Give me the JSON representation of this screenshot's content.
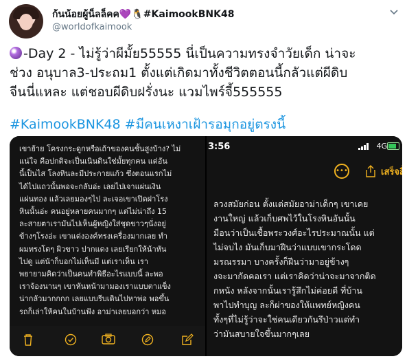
{
  "tweet": {
    "display_name": "ก้นน้อยผู้น็ลล็คค",
    "name_icons": "💜🐧",
    "name_tag": "#KaimookBNK48",
    "handle": "@worldofkaimook",
    "body_line1": "-Day 2 - ไม่รู้ว่าผีมั้ย55555 นี่เป็นความทรงจำวัยเด็ก น่าจะ",
    "body_line2": "ช่วง อนุบาล3-ประถม1 ตั้งแต่เกิดมาทั้งชีวิตตอนนี้กลัวแต่ผีดิบ",
    "body_line3": "จีนนี่แหละ แต่ชอบผีดิบฝรั่งนะ แวมไพร์จี้555555",
    "hashtags": "#KaimookBNK48 #มีคนเหงาเฝ้ารอมุกอยู่ตรงนี้",
    "more_icon": "chevron-down-icon",
    "orb_icon": "crystal-ball-icon"
  },
  "photo_left": {
    "lines": [
      "เขาย้าย โครงกระดูกหรือเถ้าของคนชั้นสูงบ้าง? ไม่",
      "แน่ใจ คือปกติจะเป็นเนินดินใช่มั้ยทุกคน แต่อัน",
      "นี้เป็นไส โลงหินละมีประกายแก้ว ซึ่งตอนแรกไม่",
      "ได้ไปแถวนั้นพอจะกลับอ่ะ เลยไปเจาแผ่นเงิน",
      "แผ่นทอง แล้วเลยมองๆไป ละเจอเขาเปิดฝาโรง",
      "หินนั้นอ่ะ คนอยู่หลายคนมากๆ แต่ไม่น่าถึง 15",
      "ละสายตาเรามันไปเห็นผู้หญิงใส่ชุดขาวๆนั่งอยู่",
      "ข้างๆโรงอ่ะ เขาแต่งองค์ทรงเครื่องมากเลย ทำ",
      "ผมทรงโตๆ ผิวขาว ปากแดง เลยเรียกให้น้าหัน",
      "ไปดู แต่น้าก็บอกไม่เห็นมี แต่เราเห็น เรา",
      "พยายามคิดว่าเป็นคนทำพิธีอะไรแบบนี้ ละพอ",
      "เราจ้องนานๆ เขาหันหน้ามามองเราแบบตาแข็ง",
      "น่ากลัวมากกกก เลยแบบรีบเดินไปหาพ่อ พอขึ้น",
      "รถก็เล่าให้คนในบ้านฟัง อาม่าเลยบอกว่า หมอ"
    ]
  },
  "photo_right": {
    "time": "3:56",
    "network": "4G",
    "battery_level": 0.8,
    "done_label": "เสร็จสิ้น",
    "lines": [
      "ลวงสมัยก่อน ตั้งแต่สมัยอาม่าเด็กๆ เขาเคย",
      "งานใหญ่ แล้วเก็บศพไว้ในโรงหินอันนั้น",
      "มือนว่าเป็นเชื้อพระวงศ์อะไรประมาณนั้น แต่",
      "ไม่จบไง มันเก็บมาฝีนว่าแบบเขากระโดด",
      "มรณรรมา บางครั้งก็ฝีนว่ามาอยู่ข้างๆ",
      "งจะมากัดคอเรา แต่เราคิดว่าน่าจะมาจากติด",
      "กหนัง หลังจากนั้นเรารู้สึกไม่ค่อยดี ที่บ้าน",
      "พาไปทำบุญ ละก็ผ่าของให้แพทย์หญิงคน",
      "ทั้งๆที่ไม่รู้ว่าจะใช่คนเดียวกันรึป่าวแต่ทำ",
      "ว่ามันสบายใจขึ้นมากๆเลย"
    ]
  },
  "toolbar_icons": [
    "trash-icon",
    "checkmark-circle-icon",
    "camera-icon",
    "pen-circle-icon",
    "compose-icon"
  ]
}
